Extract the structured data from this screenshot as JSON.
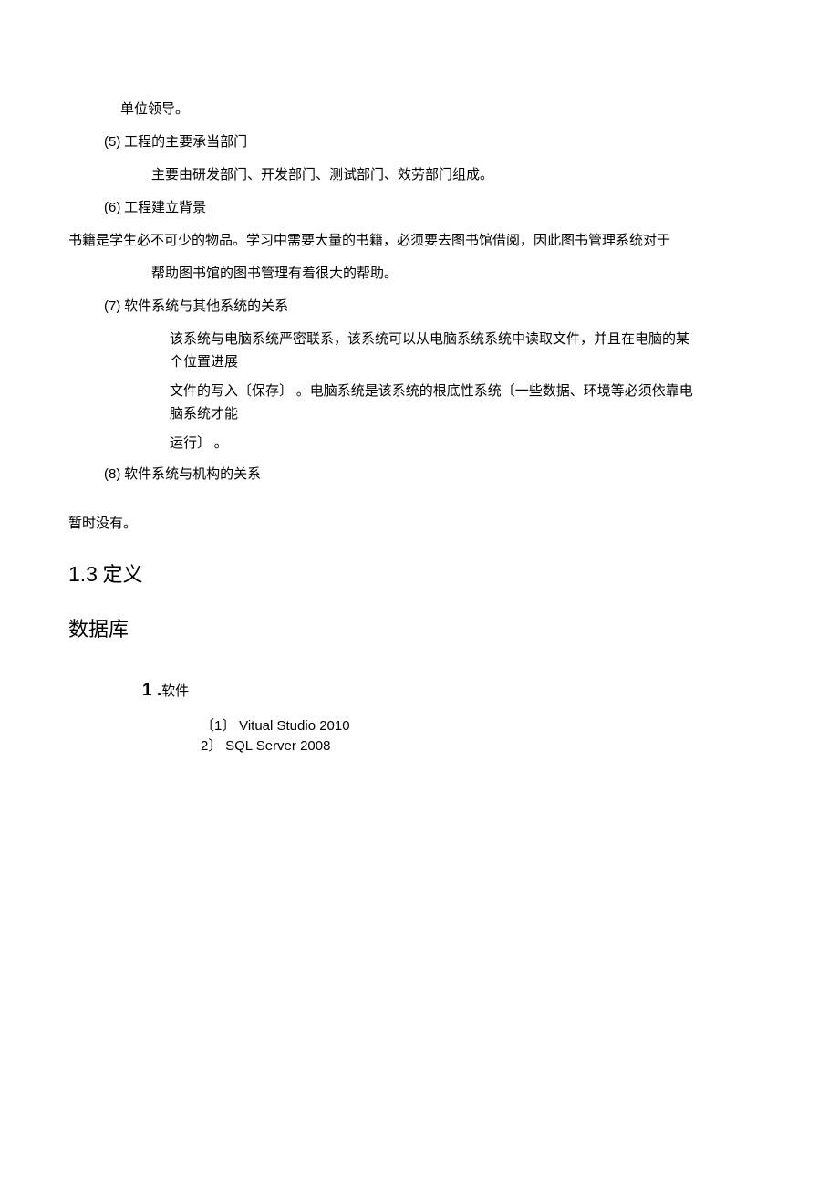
{
  "p1": "单位领导。",
  "item5": {
    "num": "(5)",
    "title": "工程的主要承当部门",
    "body": "主要由研发部门、开发部门、测试部门、效劳部门组成。"
  },
  "item6": {
    "num": "(6)",
    "title": "工程建立背景",
    "body_a": "书籍是学生必不可少的物品。学习中需要大量的书籍，必须要去图书馆借阅，因此图书管理系统对于",
    "body_b": "帮助图书馆的图书管理有着很大的帮助。"
  },
  "item7": {
    "num": "(7)",
    "title": "软件系统与其他系统的关系",
    "body_a": "该系统与电脑系统严密联系，该系统可以从电脑系统系统中读取文件，并且在电脑的某个位置进展",
    "body_b": "文件的写入〔保存〕 。电脑系统是该系统的根底性系统〔一些数据、环境等必须依靠电脑系统才能",
    "body_c": "运行〕 。"
  },
  "item8": {
    "num": "(8)",
    "title": "软件系统与机构的关系"
  },
  "noTemp": "暂时没有。",
  "heading13": {
    "num": "1.3",
    "text": "定义"
  },
  "dbHeading": "数据库",
  "software": {
    "num": "1 .",
    "label": "软件",
    "items": [
      {
        "num": "〔1〕",
        "text": "Vitual Studio 2010"
      },
      {
        "num": "2〕",
        "text": "SQL Server 2008"
      }
    ]
  }
}
